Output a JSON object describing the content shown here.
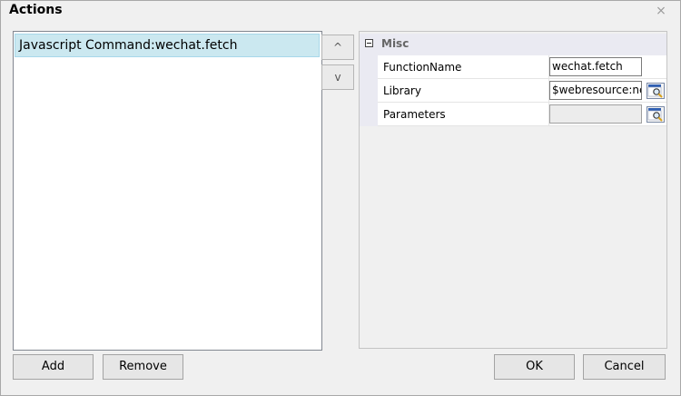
{
  "dialog": {
    "title": "Actions",
    "close_glyph": "⨯"
  },
  "actions_list": {
    "items": [
      {
        "label": "Javascript Command:wechat.fetch",
        "selected": true
      }
    ]
  },
  "reorder": {
    "up_label": "^",
    "down_label": "v"
  },
  "property_grid": {
    "category": "Misc",
    "properties": [
      {
        "name": "FunctionName",
        "value": "wechat.fetch",
        "has_picker": false,
        "disabled": false
      },
      {
        "name": "Library",
        "value": "$webresource:new",
        "has_picker": true,
        "disabled": false
      },
      {
        "name": "Parameters",
        "value": "",
        "has_picker": true,
        "disabled": true
      }
    ]
  },
  "buttons": {
    "add": "Add",
    "remove": "Remove",
    "ok": "OK",
    "cancel": "Cancel"
  },
  "colors": {
    "selection": "#cbe8f0",
    "category_bg": "#eaeaf2",
    "dialog_bg": "#f0f0f0"
  }
}
